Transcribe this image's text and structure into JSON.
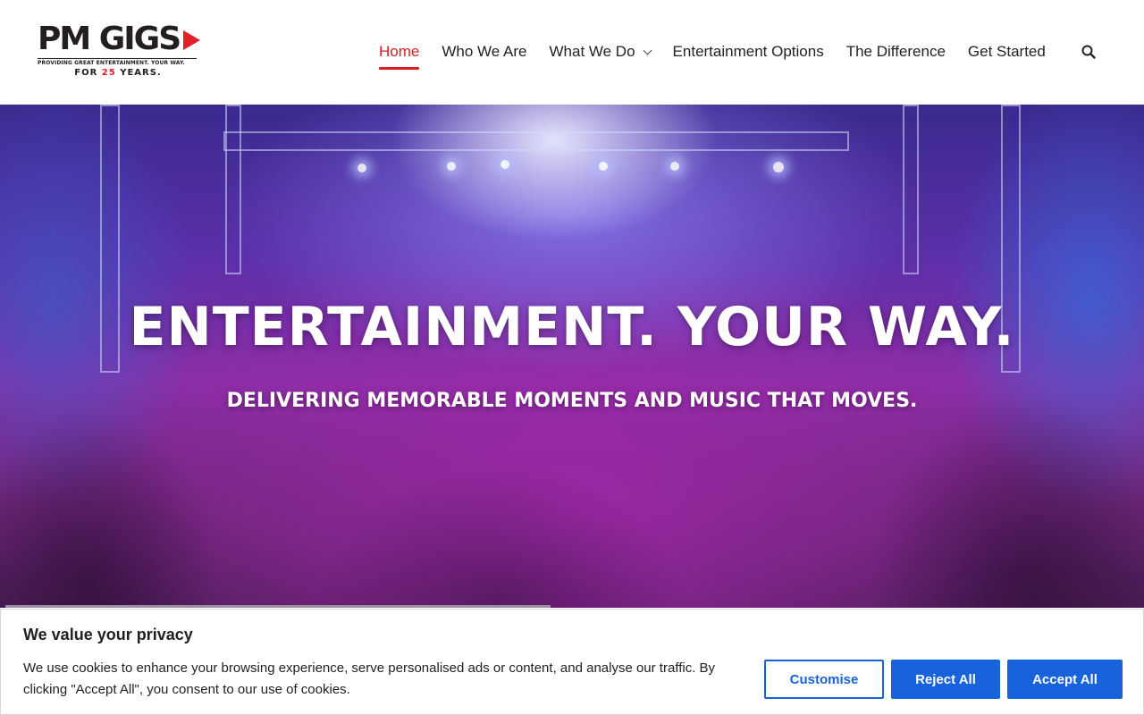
{
  "header": {
    "logo": {
      "name": "PM GIGS",
      "tagline": "PROVIDING GREAT ENTERTAINMENT. YOUR WAY.",
      "years_prefix": "FOR",
      "years_number": "25",
      "years_suffix": "YEARS."
    },
    "nav": [
      {
        "label": "Home",
        "active": true
      },
      {
        "label": "Who We Are"
      },
      {
        "label": "What We Do",
        "has_dropdown": true
      },
      {
        "label": "Entertainment Options"
      },
      {
        "label": "The Difference"
      },
      {
        "label": "Get Started"
      }
    ],
    "search_icon": "search-icon"
  },
  "hero": {
    "title": "ENTERTAINMENT. YOUR WAY.",
    "subtitle": "DELIVERING MEMORABLE MOMENTS AND MUSIC THAT MOVES."
  },
  "cookie": {
    "title": "We value your privacy",
    "text": "We use cookies to enhance your browsing experience, serve personalised ads or content, and analyse our traffic. By clicking \"Accept All\", you consent to our use of cookies.",
    "customise": "Customise",
    "reject": "Reject All",
    "accept": "Accept All"
  },
  "colors": {
    "brand_red": "#d81e22",
    "button_blue": "#1863dc"
  }
}
